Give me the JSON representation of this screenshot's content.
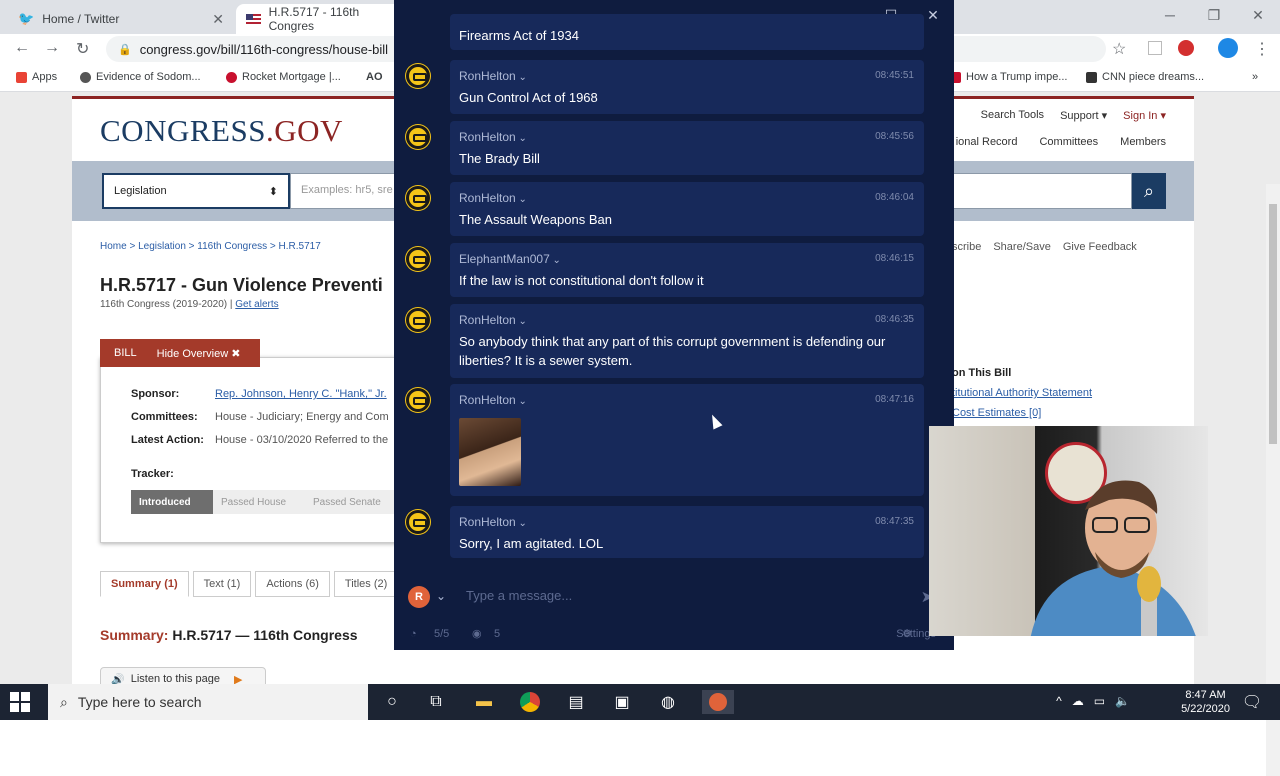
{
  "browser": {
    "tabs": [
      {
        "label": "Home / Twitter"
      },
      {
        "label": "H.R.5717 - 116th Congres"
      }
    ],
    "url": "congress.gov/bill/116th-congress/house-bill",
    "bookmarks": [
      "Apps",
      "Evidence of Sodom...",
      "Rocket Mortgage |...",
      "AO",
      "How a Trump impe...",
      "CNN piece dreams..."
    ]
  },
  "congress": {
    "logo_main": "CONGRESS",
    "logo_tld": ".GOV",
    "top_nav": [
      "Search Tools",
      "Support ▾",
      "Sign In ▾"
    ],
    "main_nav": [
      "ional Record",
      "Committees",
      "Members"
    ],
    "search_select": "Legislation",
    "search_placeholder": "Examples: hr5, sre",
    "breadcrumb": "Home > Legislation > 116th Congress > H.R.5717",
    "bill_title": "H.R.5717 - Gun Violence Preventi",
    "bill_sub": "116th Congress (2019-2020) |",
    "get_alerts": "Get alerts",
    "bill_tab": "BILL",
    "hide_overview": "Hide Overview ✖",
    "sponsor_label": "Sponsor:",
    "sponsor_value": "Rep. Johnson, Henry C. \"Hank,\" Jr.",
    "committees_label": "Committees:",
    "committees_value": "House - Judiciary; Energy and Com",
    "latest_label": "Latest Action:",
    "latest_value": "House - 03/10/2020 Referred to the",
    "tracker_label": "Tracker:",
    "tracker_steps": [
      "Introduced",
      "Passed House",
      "Passed Senate"
    ],
    "page_tabs": [
      "Summary (1)",
      "Text (1)",
      "Actions (6)",
      "Titles (2)"
    ],
    "summary_label": "Summary:",
    "summary_rest": "H.R.5717 — 116th Congress",
    "listen": "Listen to this page",
    "right_links": [
      "scribe",
      "Share/Save",
      "Give Feedback"
    ],
    "on_this_bill": "on This Bill",
    "authority": "titutional Authority Statement",
    "cost": "Cost Estimates [0]"
  },
  "chat": {
    "messages": [
      {
        "user": "",
        "time": "",
        "text": "Firearms Act of 1934"
      },
      {
        "user": "RonHelton",
        "time": "08:45:51",
        "text": "Gun Control Act of 1968"
      },
      {
        "user": "RonHelton",
        "time": "08:45:56",
        "text": "The Brady Bill"
      },
      {
        "user": "RonHelton",
        "time": "08:46:04",
        "text": "The Assault Weapons Ban"
      },
      {
        "user": "ElephantMan007",
        "time": "08:46:15",
        "text": "If the law is not constitutional don't follow it"
      },
      {
        "user": "RonHelton",
        "time": "08:46:35",
        "text": "So anybody think that any part of this corrupt government is defending our liberties? It is a sewer system."
      },
      {
        "user": "RonHelton",
        "time": "08:47:16",
        "text": ""
      },
      {
        "user": "RonHelton",
        "time": "08:47:35",
        "text": "Sorry, I am agitated. LOL"
      }
    ],
    "user_initial": "R",
    "placeholder": "Type a message...",
    "status_count": "5/5",
    "viewers": "5",
    "settings": "Settings"
  },
  "taskbar": {
    "search_placeholder": "Type here to search",
    "time": "8:47 AM",
    "date": "5/22/2020"
  }
}
